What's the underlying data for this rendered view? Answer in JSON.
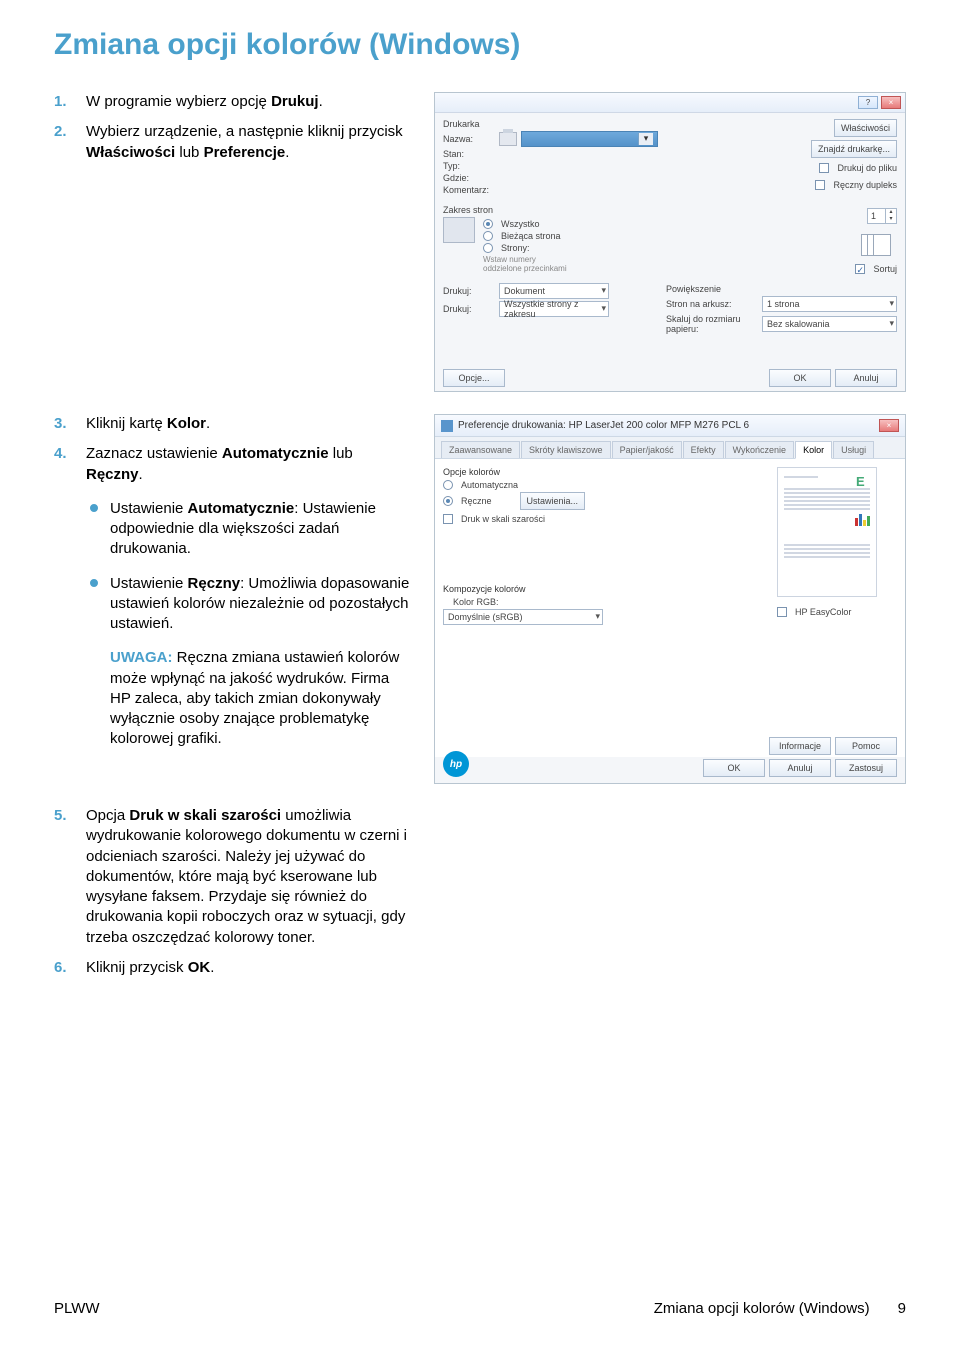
{
  "page": {
    "title": "Zmiana opcji kolorów (Windows)",
    "footerLeft": "PLWW",
    "footerCenter": "Zmiana opcji kolorów (Windows)",
    "footerPage": "9"
  },
  "steps": {
    "s1": {
      "num": "1.",
      "pre": "W programie wybierz opcję ",
      "b": "Drukuj",
      "post": "."
    },
    "s2": {
      "num": "2.",
      "pre": "Wybierz urządzenie, a następnie kliknij przycisk ",
      "b1": "Właściwości",
      "mid": " lub ",
      "b2": "Preferencje",
      "post": "."
    },
    "s3": {
      "num": "3.",
      "pre": "Kliknij kartę ",
      "b": "Kolor",
      "post": "."
    },
    "s4": {
      "num": "4.",
      "pre": "Zaznacz ustawienie ",
      "b1": "Automatycznie",
      "mid": " lub ",
      "b2": "Ręczny",
      "post": "."
    },
    "bullets": [
      {
        "label": "Automatycznie",
        "pre": "Ustawienie ",
        "post": ": Ustawienie odpowiednie dla większości zadań drukowania."
      },
      {
        "label": "Ręczny",
        "pre": "Ustawienie ",
        "post": ": Umożliwia dopasowanie ustawień kolorów niezależnie od pozostałych ustawień."
      }
    ],
    "note": {
      "label": "UWAGA:",
      "text": " Ręczna zmiana ustawień kolorów może wpłynąć na jakość wydruków. Firma HP zaleca, aby takich zmian dokonywały wyłącznie osoby znające problematykę kolorowej grafiki."
    },
    "s5": {
      "num": "5.",
      "pre": "Opcja ",
      "b": "Druk w skali szarości",
      "post": " umożliwia wydrukowanie kolorowego dokumentu w czerni i odcieniach szarości. Należy jej używać do dokumentów, które mają być kserowane lub wysyłane faksem. Przydaje się również do drukowania kopii roboczych oraz w sytuacji, gdy trzeba oszczędzać kolorowy toner."
    },
    "s6": {
      "num": "6.",
      "pre": "Kliknij przycisk ",
      "b": "OK",
      "post": "."
    }
  },
  "shot1": {
    "grpPrinter": "Drukarka",
    "name": "Nazwa:",
    "state": "Stan:",
    "type": "Typ:",
    "where": "Gdzie:",
    "comment": "Komentarz:",
    "btnProps": "Właściwości",
    "btnFind": "Znajdź drukarkę...",
    "chkFile": "Drukuj do pliku",
    "chkDuplex": "Ręczny dupleks",
    "grpScope": "Zakres stron",
    "rAll": "Wszystko",
    "rCurrent": "Bieżąca strona",
    "rPages": "Strony:",
    "scopeNote1": "Wstaw numery",
    "scopeNote2": "oddzielone przecinkami",
    "copies": "1",
    "chkCollate": "Sortuj",
    "printLbl1": "Drukuj:",
    "printVal1": "Dokument",
    "printLbl2": "Drukuj:",
    "printVal2": "Wszystkie strony z zakresu",
    "grpZoom": "Powiększenie",
    "ppsLabel": "Stron na arkusz:",
    "ppsValue": "1 strona",
    "scaleLabel": "Skaluj do rozmiaru papieru:",
    "scaleValue": "Bez skalowania",
    "btnOptions": "Opcje...",
    "btnOK": "OK",
    "btnCancel": "Anuluj"
  },
  "shot2": {
    "title": "Preferencje drukowania: HP LaserJet 200 color MFP M276 PCL 6",
    "tabs": [
      "Zaawansowane",
      "Skróty klawiszowe",
      "Papier/jakość",
      "Efekty",
      "Wykończenie",
      "Kolor",
      "Usługi"
    ],
    "activeTab": 5,
    "grpColorOptions": "Opcje kolorów",
    "optAuto": "Automatyczna",
    "optManual": "Ręczne",
    "btnSettings": "Ustawienia...",
    "chkGray": "Druk w skali szarości",
    "chkEasyColor": "HP EasyColor",
    "grpComposition": "Kompozycje kolorów",
    "compLabel": "Kolor RGB:",
    "compValue": "Domyślnie (sRGB)",
    "hpLogo": "hp",
    "btnInfo": "Informacje",
    "btnHelp": "Pomoc",
    "btnOK": "OK",
    "btnCancel": "Anuluj",
    "btnApply": "Zastosuj"
  }
}
